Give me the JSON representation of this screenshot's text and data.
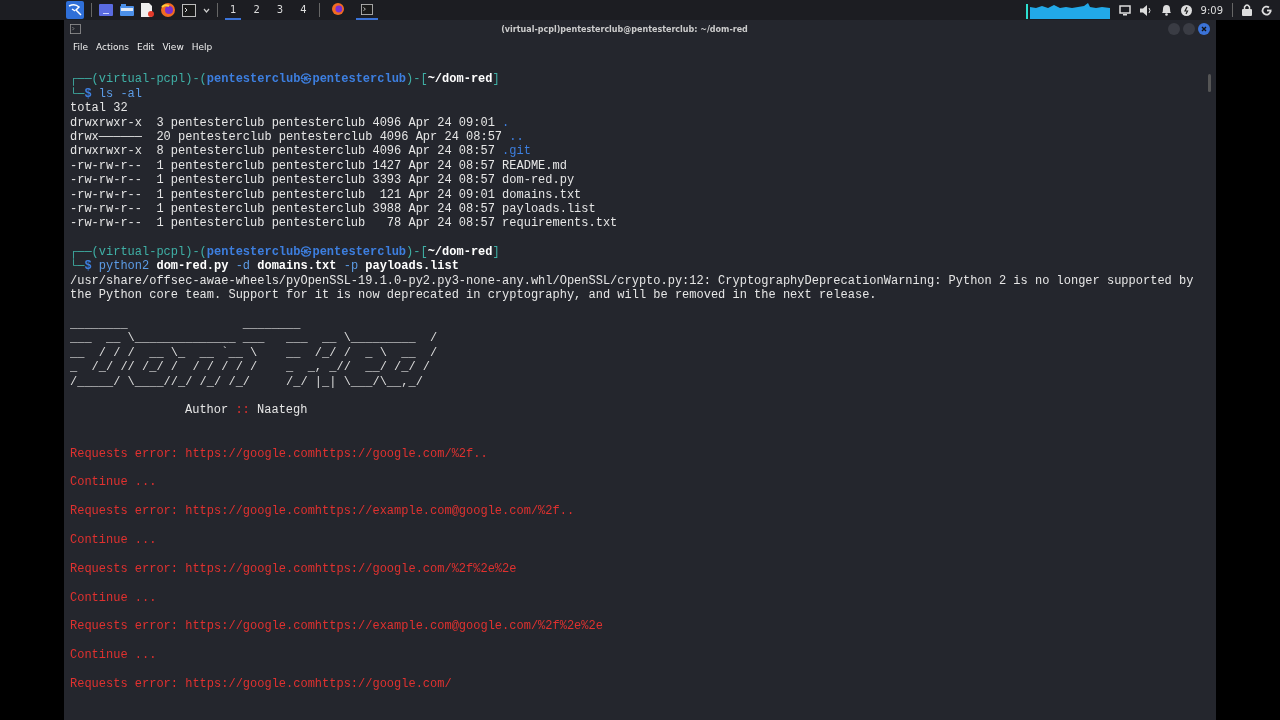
{
  "taskbar": {
    "workspaces": [
      {
        "label": "1",
        "selected": true
      },
      {
        "label": "2",
        "selected": false
      },
      {
        "label": "3",
        "selected": false
      },
      {
        "label": "4",
        "selected": false
      }
    ],
    "tasks": [
      {
        "kind": "browser",
        "selected": false
      },
      {
        "kind": "terminal",
        "selected": true
      }
    ],
    "clock": "9:09"
  },
  "window": {
    "title": "(virtual-pcpl)pentesterclub@pentesterclub: ~/dom-red"
  },
  "menu": [
    "File",
    "Actions",
    "Edit",
    "View",
    "Help"
  ],
  "terminal": {
    "lines": [
      {
        "kind": "blank"
      },
      {
        "kind": "prompt",
        "head": "┌──(virtual-pcpl)-(",
        "user": "pentesterclub㉿pentesterclub",
        "mid": ")-[",
        "path": "~/dom-red",
        "tail": "]"
      },
      {
        "kind": "command",
        "corner": "└─",
        "sigil": "$",
        "parts": [
          {
            "kind": "program",
            "text": "ls"
          },
          {
            "kind": "flag",
            "text": "-al"
          }
        ]
      },
      {
        "kind": "output",
        "text": "total 32"
      },
      {
        "kind": "entry",
        "text": "drwxrwxr-x  3 pentesterclub pentesterclub 4096 Apr 24 09:01",
        "name": ".",
        "directory": true
      },
      {
        "kind": "entry",
        "text": "drwx──────  20 pentesterclub pentesterclub 4096 Apr 24 08:57",
        "name": "..",
        "directory": true
      },
      {
        "kind": "entry",
        "text": "drwxrwxr-x  8 pentesterclub pentesterclub 4096 Apr 24 08:57",
        "name": ".git",
        "directory": true
      },
      {
        "kind": "entry",
        "text": "-rw-rw-r--  1 pentesterclub pentesterclub 1427 Apr 24 08:57",
        "name": "README.md",
        "directory": false
      },
      {
        "kind": "entry",
        "text": "-rw-rw-r--  1 pentesterclub pentesterclub 3393 Apr 24 08:57",
        "name": "dom-red.py",
        "directory": false
      },
      {
        "kind": "entry",
        "text": "-rw-rw-r--  1 pentesterclub pentesterclub  121 Apr 24 09:01",
        "name": "domains.txt",
        "directory": false
      },
      {
        "kind": "entry",
        "text": "-rw-rw-r--  1 pentesterclub pentesterclub 3988 Apr 24 08:57",
        "name": "payloads.list",
        "directory": false
      },
      {
        "kind": "entry",
        "text": "-rw-rw-r--  1 pentesterclub pentesterclub   78 Apr 24 08:57",
        "name": "requirements.txt",
        "directory": false
      },
      {
        "kind": "blank"
      },
      {
        "kind": "prompt",
        "head": "┌──(virtual-pcpl)-(",
        "user": "pentesterclub㉿pentesterclub",
        "mid": ")-[",
        "path": "~/dom-red",
        "tail": "]"
      },
      {
        "kind": "command",
        "corner": "└─",
        "sigil": "$",
        "parts": [
          {
            "kind": "program",
            "text": "python2"
          },
          {
            "kind": "file",
            "text": "dom-red.py"
          },
          {
            "kind": "flag",
            "text": "-d"
          },
          {
            "kind": "file",
            "text": "domains.txt"
          },
          {
            "kind": "flag",
            "text": "-p"
          },
          {
            "kind": "file",
            "text": "payloads.list"
          }
        ]
      },
      {
        "kind": "output",
        "text": "/usr/share/offsec-awae-wheels/pyOpenSSL-19.1.0-py2.py3-none-any.whl/OpenSSL/crypto.py:12: CryptographyDeprecationWarning: Python 2 is no longer supported by"
      },
      {
        "kind": "output",
        "text": "the Python core team. Support for it is now deprecated in cryptography, and will be removed in the next release."
      },
      {
        "kind": "blank"
      },
      {
        "kind": "art",
        "lines": [
          "________                ________",
          "___  __ \\______________ ___   ___  __ \\_________  /",
          "__  / / /  __ \\_  __ `__ \\    __  /_/ /  _ \\  __  /",
          "_  /_/ // /_/ /  / / / / /    _  _, _//  __/ /_/ /",
          "/_____/ \\____//_/ /_/ /_/     /_/ |_| \\___/\\__,_/"
        ]
      },
      {
        "kind": "blank"
      },
      {
        "kind": "author",
        "label": "Author",
        "separator": "::",
        "name": "Naategh"
      },
      {
        "kind": "blank"
      },
      {
        "kind": "blank"
      },
      {
        "kind": "error",
        "text": "Requests error: https://google.comhttps://google.com/%2f.."
      },
      {
        "kind": "blank"
      },
      {
        "kind": "error",
        "text": "Continue ..."
      },
      {
        "kind": "blank"
      },
      {
        "kind": "error",
        "text": "Requests error: https://google.comhttps://example.com@google.com/%2f.."
      },
      {
        "kind": "blank"
      },
      {
        "kind": "error",
        "text": "Continue ..."
      },
      {
        "kind": "blank"
      },
      {
        "kind": "error",
        "text": "Requests error: https://google.comhttps://google.com/%2f%2e%2e"
      },
      {
        "kind": "blank"
      },
      {
        "kind": "error",
        "text": "Continue ..."
      },
      {
        "kind": "blank"
      },
      {
        "kind": "error",
        "text": "Requests error: https://google.comhttps://example.com@google.com/%2f%2e%2e"
      },
      {
        "kind": "blank"
      },
      {
        "kind": "error",
        "text": "Continue ..."
      },
      {
        "kind": "blank"
      },
      {
        "kind": "error",
        "text": "Requests error: https://google.comhttps://google.com/"
      }
    ]
  }
}
